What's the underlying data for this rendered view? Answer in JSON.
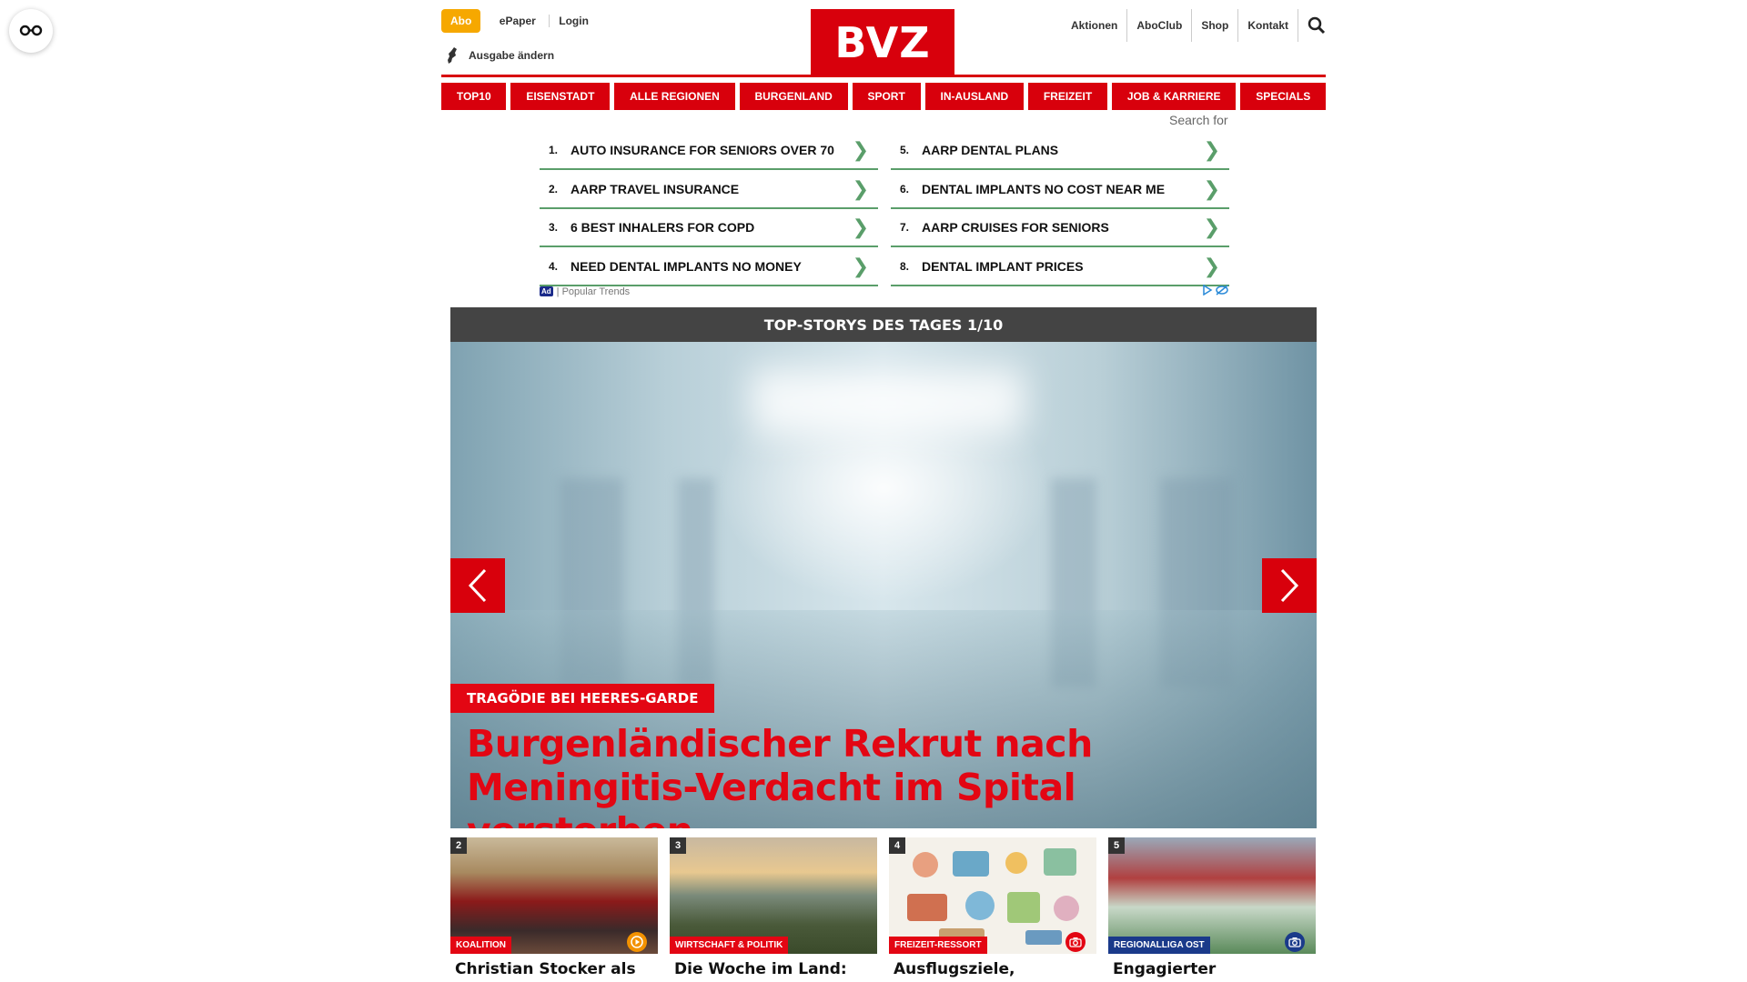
{
  "header": {
    "abo_label": "Abo",
    "epaper_label": "ePaper",
    "login_label": "Login",
    "edition_label": "Ausgabe ändern",
    "logo_text": "BVZ",
    "right_links": [
      "Aktionen",
      "AboClub",
      "Shop",
      "Kontakt"
    ]
  },
  "nav": {
    "items": [
      "TOP10",
      "EISENSTADT",
      "ALLE REGIONEN",
      "BURGENLAND",
      "SPORT",
      "IN-AUSLAND",
      "FREIZEIT",
      "JOB & KARRIERE",
      "SPECIALS"
    ]
  },
  "ads": {
    "search_for": "Search for",
    "left": [
      {
        "num": "1.",
        "text": "AUTO INSURANCE FOR SENIORS OVER 70"
      },
      {
        "num": "2.",
        "text": "AARP TRAVEL INSURANCE"
      },
      {
        "num": "3.",
        "text": "6 BEST INHALERS FOR COPD"
      },
      {
        "num": "4.",
        "text": "NEED DENTAL IMPLANTS NO MONEY"
      }
    ],
    "right": [
      {
        "num": "5.",
        "text": "AARP DENTAL PLANS"
      },
      {
        "num": "6.",
        "text": "DENTAL IMPLANTS NO COST NEAR ME"
      },
      {
        "num": "7.",
        "text": "AARP CRUISES FOR SENIORS"
      },
      {
        "num": "8.",
        "text": "DENTAL IMPLANT PRICES"
      }
    ],
    "chevron": "❯",
    "badge": "Ad",
    "footer_text": "| Popular Trends"
  },
  "top_stories": {
    "bar_title": "TOP-STORYS DES TAGES 1/10",
    "kicker": "TRAGÖDIE BEI HEERES-GARDE",
    "headline": "Burgenländischer Rekrut nach Meningitis-Verdacht im Spital verstorben"
  },
  "cards": [
    {
      "num": "2",
      "tag": "KOALITION",
      "title": "Christian Stocker als Bundeskanzler angelobt",
      "icon": "play-icon"
    },
    {
      "num": "3",
      "tag": "WIRTSCHAFT & POLITIK",
      "title": "Die Woche im Land: Fasching, Energie-",
      "icon": ""
    },
    {
      "num": "4",
      "tag": "FREIZEIT-RESSORT",
      "title": "Ausflugsziele, Rezepte, Gesundheitstipps und",
      "icon": "camera-icon"
    },
    {
      "num": "5",
      "tag": "REGIONALLIGA OST",
      "title": "Engagierter Siegendorfer Auftritt",
      "icon": "camera-icon"
    }
  ],
  "colors": {
    "brand_red": "#d8000c",
    "accent_orange": "#f6a800",
    "ad_green": "#5a9e6a",
    "tag_blue": "#1a3a8a"
  }
}
